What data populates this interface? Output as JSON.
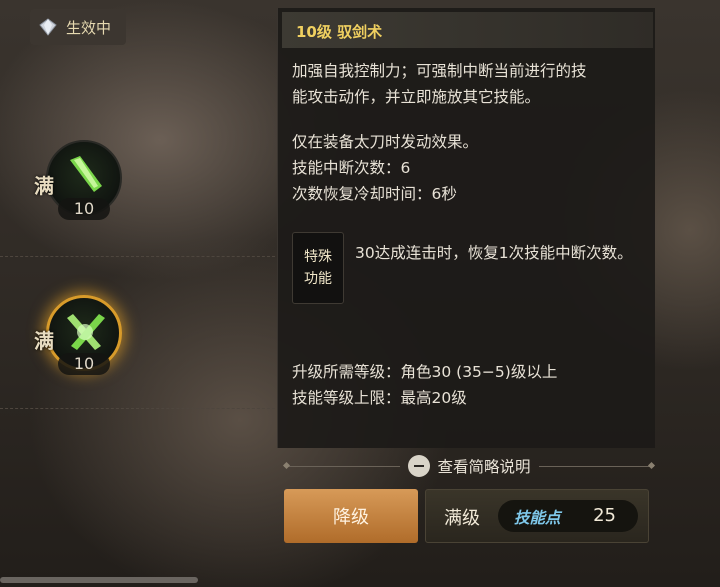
{
  "status": {
    "icon": "diamond-icon",
    "label": "生效中"
  },
  "skills": [
    {
      "max_label": "满",
      "level": "10",
      "icon": "sword-slash-icon",
      "highlighted": false
    },
    {
      "max_label": "满",
      "level": "10",
      "icon": "cross-slash-icon",
      "highlighted": true
    }
  ],
  "panel": {
    "title": "10级 驭剑术",
    "desc_line1": "加强自我控制力；可强制中断当前进行的技",
    "desc_line2": "能攻击动作，并立即施放其它技能。",
    "cond_line1": "仅在装备太刀时发动效果。",
    "cond_line2": "技能中断次数：6",
    "cond_line3": "次数恢复冷却时间：6秒",
    "special_badge_line1": "特殊",
    "special_badge_line2": "功能",
    "special_text": "30达成连击时，恢复1次技能中断次数。",
    "req_line1": "升级所需等级：角色30 (35−5)级以上",
    "req_line2": "技能等级上限：最高20级"
  },
  "toggle": {
    "label": "查看简略说明",
    "icon": "minus-icon"
  },
  "buttons": {
    "downgrade": "降级",
    "max": "满级"
  },
  "points": {
    "label": "技能点",
    "value": "25"
  },
  "colors": {
    "title": "#f0d060",
    "accent_orange": "#c98542",
    "points_label": "#7fc8ea"
  }
}
